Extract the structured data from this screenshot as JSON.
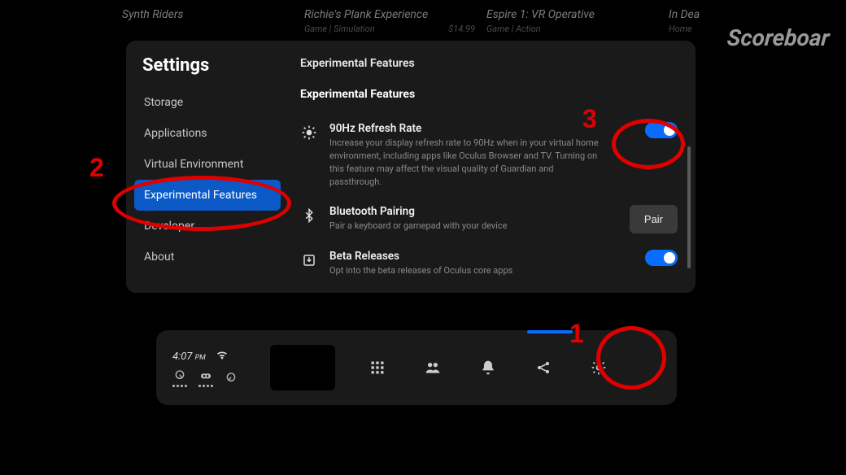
{
  "background": {
    "cards": [
      {
        "title": "Synth Riders",
        "meta": ""
      },
      {
        "title": "Richie's Plank Experience",
        "meta": "Game | Simulation",
        "price": "$14.99"
      },
      {
        "title": "Espire 1: VR Operative",
        "meta": "Game | Action"
      },
      {
        "title": "In Dea",
        "meta": "Home"
      }
    ],
    "scoreboard": "Scoreboar"
  },
  "settings": {
    "title": "Settings",
    "items": [
      {
        "label": "Storage"
      },
      {
        "label": "Applications"
      },
      {
        "label": "Virtual Environment"
      },
      {
        "label": "Experimental Features",
        "selected": true
      },
      {
        "label": "Developer"
      },
      {
        "label": "About"
      }
    ],
    "breadcrumb": "Experimental Features",
    "section_title": "Experimental Features",
    "rows": {
      "refresh": {
        "title": "90Hz Refresh Rate",
        "desc": "Increase your display refresh rate to 90Hz when in your virtual home environment, including apps like Oculus Browser and TV. Turning on this feature may affect the visual quality of Guardian and passthrough.",
        "toggle": true
      },
      "bluetooth": {
        "title": "Bluetooth Pairing",
        "desc": "Pair a keyboard or gamepad with your device",
        "button": "Pair"
      },
      "beta": {
        "title": "Beta Releases",
        "desc": "Opt into the beta releases of Oculus core apps",
        "toggle": true
      }
    }
  },
  "dock": {
    "time": "4:07",
    "time_suffix": "PM"
  },
  "annotations": {
    "n1": "1",
    "n2": "2",
    "n3": "3"
  }
}
